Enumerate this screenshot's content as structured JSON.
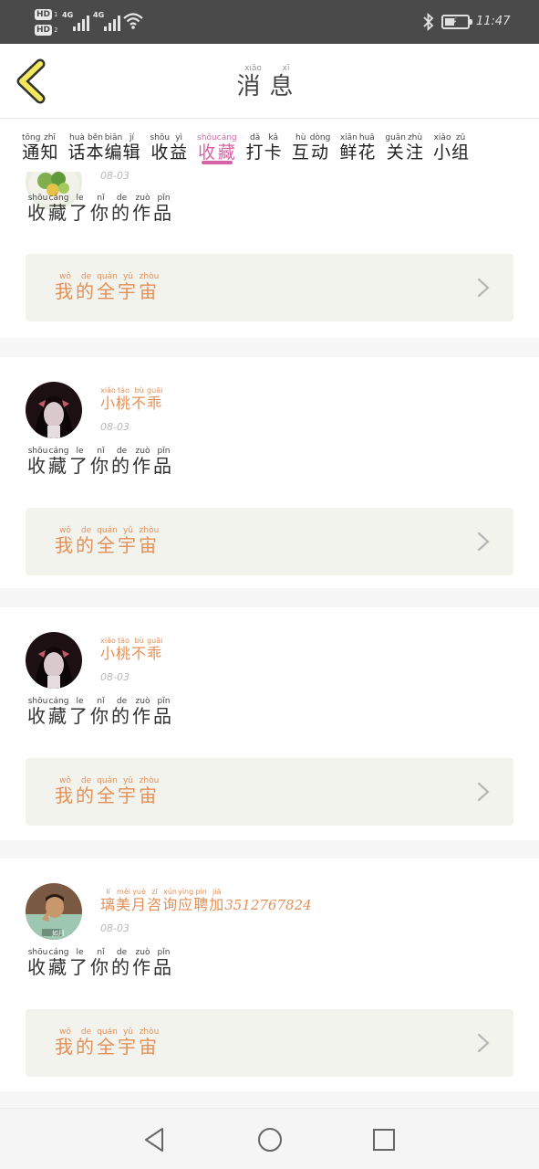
{
  "status_bar": {
    "sim1_label": "HD",
    "sim1_num": "1",
    "sim2_label": "HD",
    "sim2_num": "2",
    "network1": "4G",
    "network2": "4G",
    "time": "11:47"
  },
  "header": {
    "title_chars": [
      {
        "char": "消",
        "pinyin": "xiāo"
      },
      {
        "char": "息",
        "pinyin": "xī"
      }
    ]
  },
  "tabs": [
    {
      "chars": [
        {
          "char": "通",
          "pinyin": "tōng"
        },
        {
          "char": "知",
          "pinyin": "zhī"
        }
      ],
      "active": false
    },
    {
      "chars": [
        {
          "char": "话",
          "pinyin": "huà"
        },
        {
          "char": "本",
          "pinyin": "běn"
        },
        {
          "char": "编",
          "pinyin": "biān"
        },
        {
          "char": "辑",
          "pinyin": "jí"
        }
      ],
      "active": false
    },
    {
      "chars": [
        {
          "char": "收",
          "pinyin": "shōu"
        },
        {
          "char": "益",
          "pinyin": "yì"
        }
      ],
      "active": false
    },
    {
      "chars": [
        {
          "char": "收",
          "pinyin": "shōu"
        },
        {
          "char": "藏",
          "pinyin": "cáng"
        }
      ],
      "active": true
    },
    {
      "chars": [
        {
          "char": "打",
          "pinyin": "dǎ"
        },
        {
          "char": "卡",
          "pinyin": "kǎ"
        }
      ],
      "active": false
    },
    {
      "chars": [
        {
          "char": "互",
          "pinyin": "hù"
        },
        {
          "char": "动",
          "pinyin": "dòng"
        }
      ],
      "active": false
    },
    {
      "chars": [
        {
          "char": "鲜",
          "pinyin": "xiān"
        },
        {
          "char": "花",
          "pinyin": "huā"
        }
      ],
      "active": false
    },
    {
      "chars": [
        {
          "char": "关",
          "pinyin": "guān"
        },
        {
          "char": "注",
          "pinyin": "zhù"
        }
      ],
      "active": false
    },
    {
      "chars": [
        {
          "char": "小",
          "pinyin": "xiǎo"
        },
        {
          "char": "组",
          "pinyin": "zǔ"
        }
      ],
      "active": false
    }
  ],
  "colors": {
    "accent_pink": "#d763a6",
    "name_orange": "#e39058",
    "link_bg": "#f3f3ee"
  },
  "action_chars": [
    {
      "char": "收",
      "pinyin": "shōu"
    },
    {
      "char": "藏",
      "pinyin": "cáng"
    },
    {
      "char": "了",
      "pinyin": "le"
    },
    {
      "char": "你",
      "pinyin": "nǐ"
    },
    {
      "char": "的",
      "pinyin": "de"
    },
    {
      "char": "作",
      "pinyin": "zuò"
    },
    {
      "char": "品",
      "pinyin": "pǐn"
    }
  ],
  "link_chars": [
    {
      "char": "我",
      "pinyin": "wǒ"
    },
    {
      "char": "的",
      "pinyin": "de"
    },
    {
      "char": "全",
      "pinyin": "quán"
    },
    {
      "char": "宇",
      "pinyin": "yǔ"
    },
    {
      "char": "宙",
      "pinyin": "zhòu"
    }
  ],
  "messages": [
    {
      "user_chars": [],
      "user_extra": "",
      "date": "08-03",
      "avatar_icon": "salad-avatar",
      "partial": true
    },
    {
      "user_chars": [
        {
          "char": "小",
          "pinyin": "xiǎo"
        },
        {
          "char": "桃",
          "pinyin": "táo"
        },
        {
          "char": "不",
          "pinyin": "bù"
        },
        {
          "char": "乖",
          "pinyin": "guāi"
        }
      ],
      "user_extra": "",
      "date": "08-03",
      "avatar_icon": "girl-avatar",
      "partial": false
    },
    {
      "user_chars": [
        {
          "char": "小",
          "pinyin": "xiǎo"
        },
        {
          "char": "桃",
          "pinyin": "táo"
        },
        {
          "char": "不",
          "pinyin": "bù"
        },
        {
          "char": "乖",
          "pinyin": "guāi"
        }
      ],
      "user_extra": "",
      "date": "08-03",
      "avatar_icon": "girl-avatar",
      "partial": false
    },
    {
      "user_chars": [
        {
          "char": "璃",
          "pinyin": "lí"
        },
        {
          "char": "美",
          "pinyin": "měi"
        },
        {
          "char": "月",
          "pinyin": "yuè"
        },
        {
          "char": "咨",
          "pinyin": "zī"
        },
        {
          "char": "询",
          "pinyin": "xún"
        },
        {
          "char": "应",
          "pinyin": "yìng"
        },
        {
          "char": "聘",
          "pinyin": "pìn"
        },
        {
          "char": "加",
          "pinyin": "jiā"
        }
      ],
      "user_extra": "3512767824",
      "date": "08-03",
      "avatar_icon": "man-avatar",
      "partial": false
    }
  ]
}
